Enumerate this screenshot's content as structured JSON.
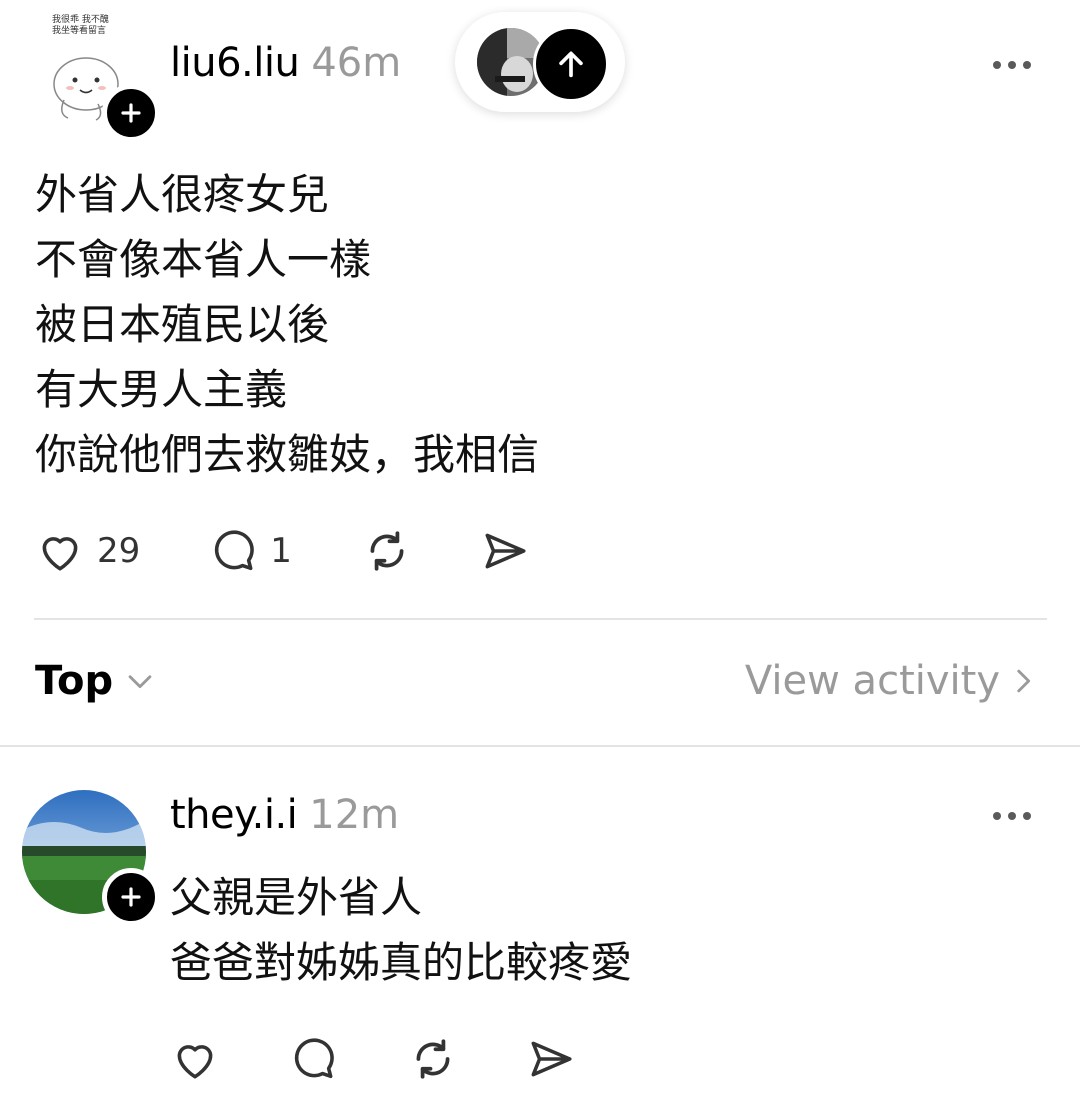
{
  "post": {
    "username": "liu6.liu",
    "time": "46m",
    "avatar_caption": "我很乖 我不醜\n我坐等看留言",
    "text": "外省人很疼女兒\n不會像本省人一樣\n被日本殖民以後\n有大男人主義\n你說他們去救雛妓，我相信",
    "likes": "29",
    "comments": "1"
  },
  "sort_bar": {
    "label": "Top",
    "view_activity": "View activity"
  },
  "reply": {
    "username": "they.i.i",
    "time": "12m",
    "text": "父親是外省人\n爸爸對姊姊真的比較疼愛"
  },
  "icons": [
    "plus-icon",
    "more-icon",
    "arrow-up-icon",
    "heart-icon",
    "comment-icon",
    "repost-icon",
    "share-icon",
    "chevron-down-icon",
    "chevron-right-icon"
  ],
  "colors": {
    "muted": "#9a9a9a",
    "divider": "#e4e4e4",
    "badge": "#000000"
  }
}
